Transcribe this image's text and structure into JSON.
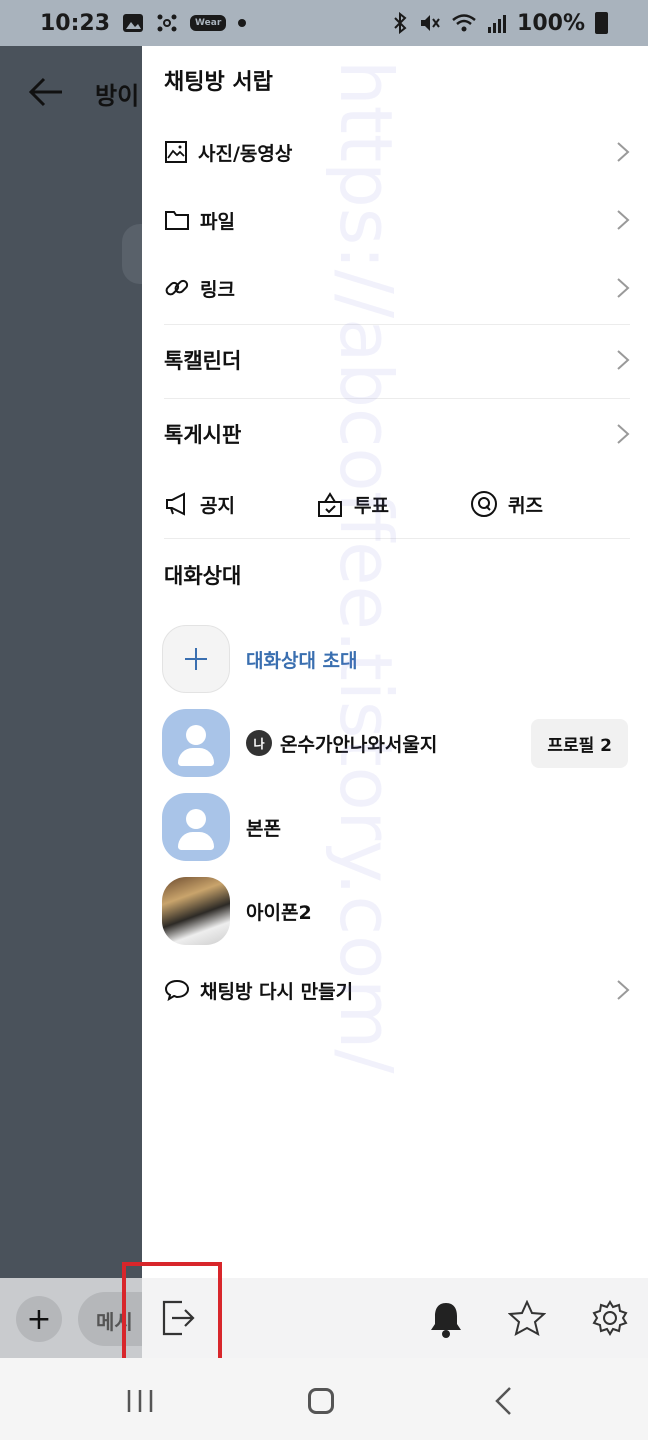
{
  "status_bar": {
    "time": "10:23",
    "wear_label": "Wear",
    "battery": "100%"
  },
  "chat_background": {
    "title_partial": "방이",
    "input_placeholder_partial": "메시"
  },
  "drawer": {
    "title": "채팅방 서랍",
    "items": [
      {
        "label": "사진/동영상",
        "icon": "image-icon"
      },
      {
        "label": "파일",
        "icon": "folder-icon"
      },
      {
        "label": "링크",
        "icon": "link-icon"
      }
    ],
    "talk_calendar": "톡캘린더",
    "talk_board": "톡게시판",
    "actions": [
      {
        "label": "공지",
        "icon": "megaphone-icon"
      },
      {
        "label": "투표",
        "icon": "vote-box-icon"
      },
      {
        "label": "퀴즈",
        "icon": "quiz-q-icon"
      }
    ],
    "members_title": "대화상대",
    "invite_label": "대화상대 초대",
    "members": [
      {
        "name": "온수가안나와서울지",
        "me_badge": "나",
        "profile_button": "프로필 2"
      },
      {
        "name": "본폰"
      },
      {
        "name": "아이폰2"
      }
    ],
    "recreate_label": "채팅방 다시 만들기"
  },
  "bottom_bar": {
    "icons": [
      "exit-icon",
      "bell-icon",
      "star-icon",
      "gear-icon"
    ],
    "highlight_color": "#d8262b"
  },
  "watermark_text": "https://abcoffee.tistory.com/"
}
